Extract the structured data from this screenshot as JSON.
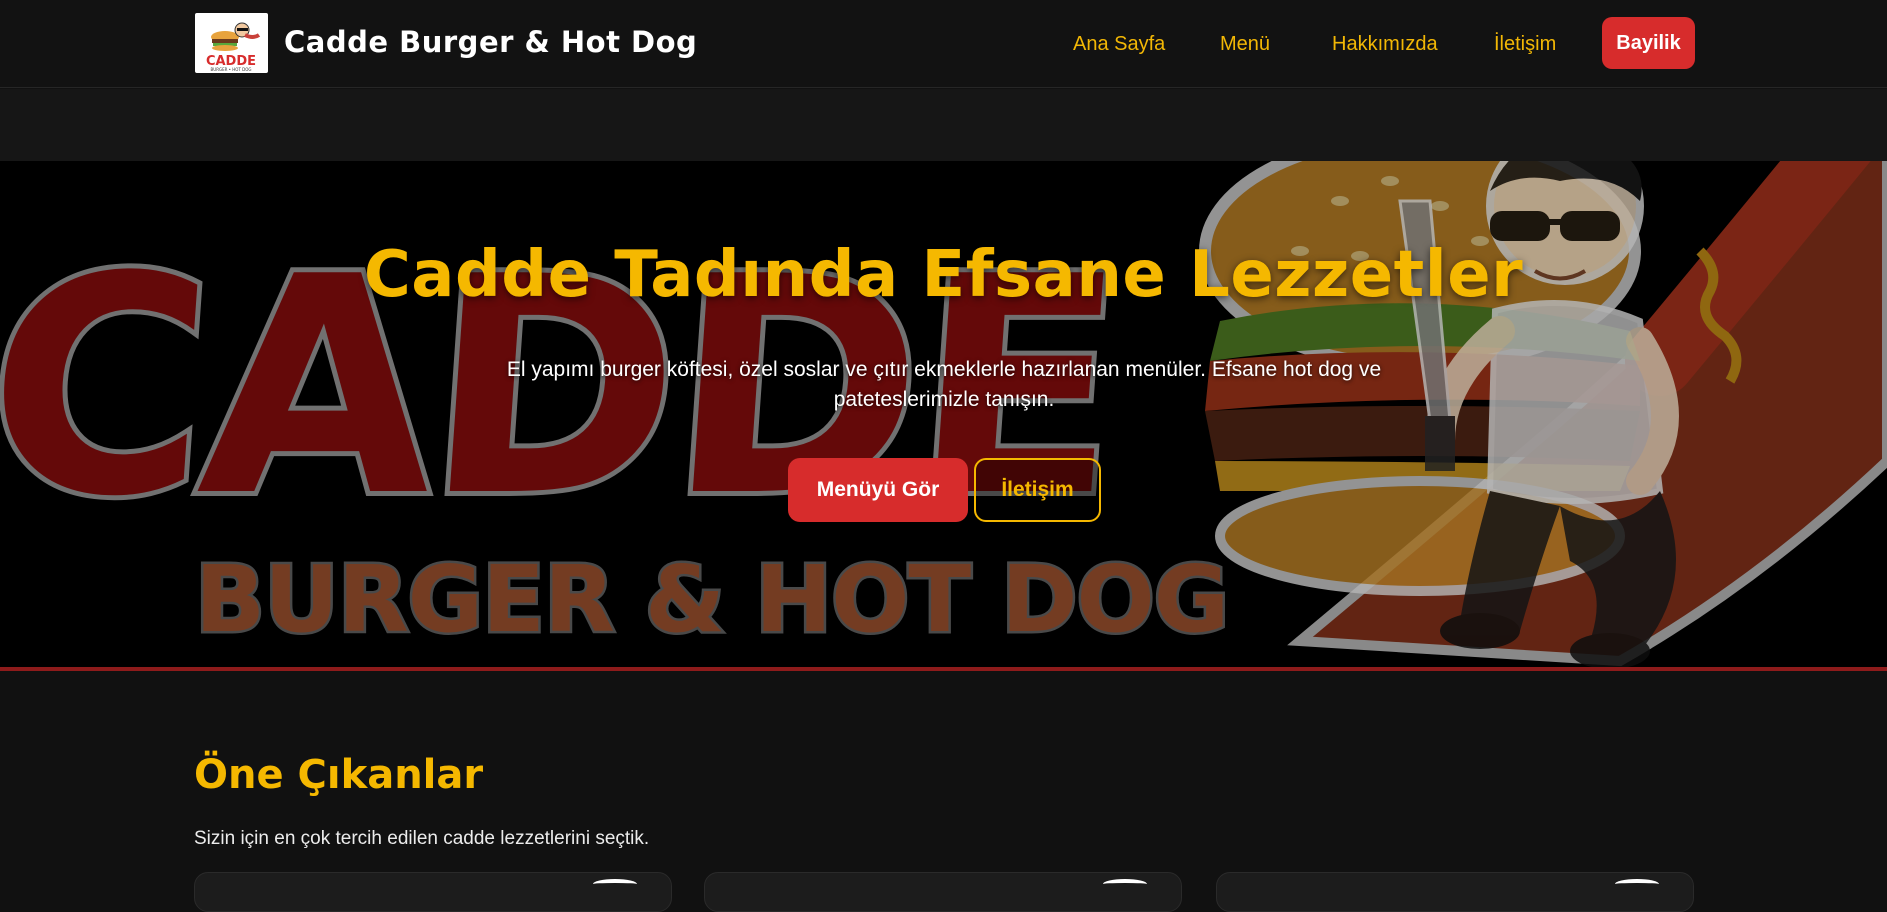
{
  "header": {
    "logo_text": "CADDE",
    "logo_sub": "BURGER • HOT DOG",
    "brand": "Cadde Burger & Hot Dog",
    "nav": [
      {
        "label": "Ana Sayfa"
      },
      {
        "label": "Menü"
      },
      {
        "label": "Hakkımızda"
      },
      {
        "label": "İletişim"
      }
    ],
    "cta": "Bayilik"
  },
  "hero": {
    "art_big": "CADDE",
    "art_small": "BURGER & HOT DOG",
    "title": "Cadde Tadında Efsane Lezzetler",
    "text": "El yapımı burger köftesi, özel soslar ve çıtır ekmeklerle hazırlanan menüler. Efsane hot dog ve pateteslerimizle tanışın.",
    "btn_primary": "Menüyü Gör",
    "btn_secondary": "İletişim"
  },
  "featured": {
    "title": "Öne Çıkanlar",
    "subtitle": "Sizin için en çok tercih edilen cadde lezzetlerini seçtik.",
    "cards": [
      {},
      {},
      {}
    ]
  },
  "colors": {
    "accent_yellow": "#f5b800",
    "accent_red": "#d72c2c",
    "background": "#111111"
  }
}
